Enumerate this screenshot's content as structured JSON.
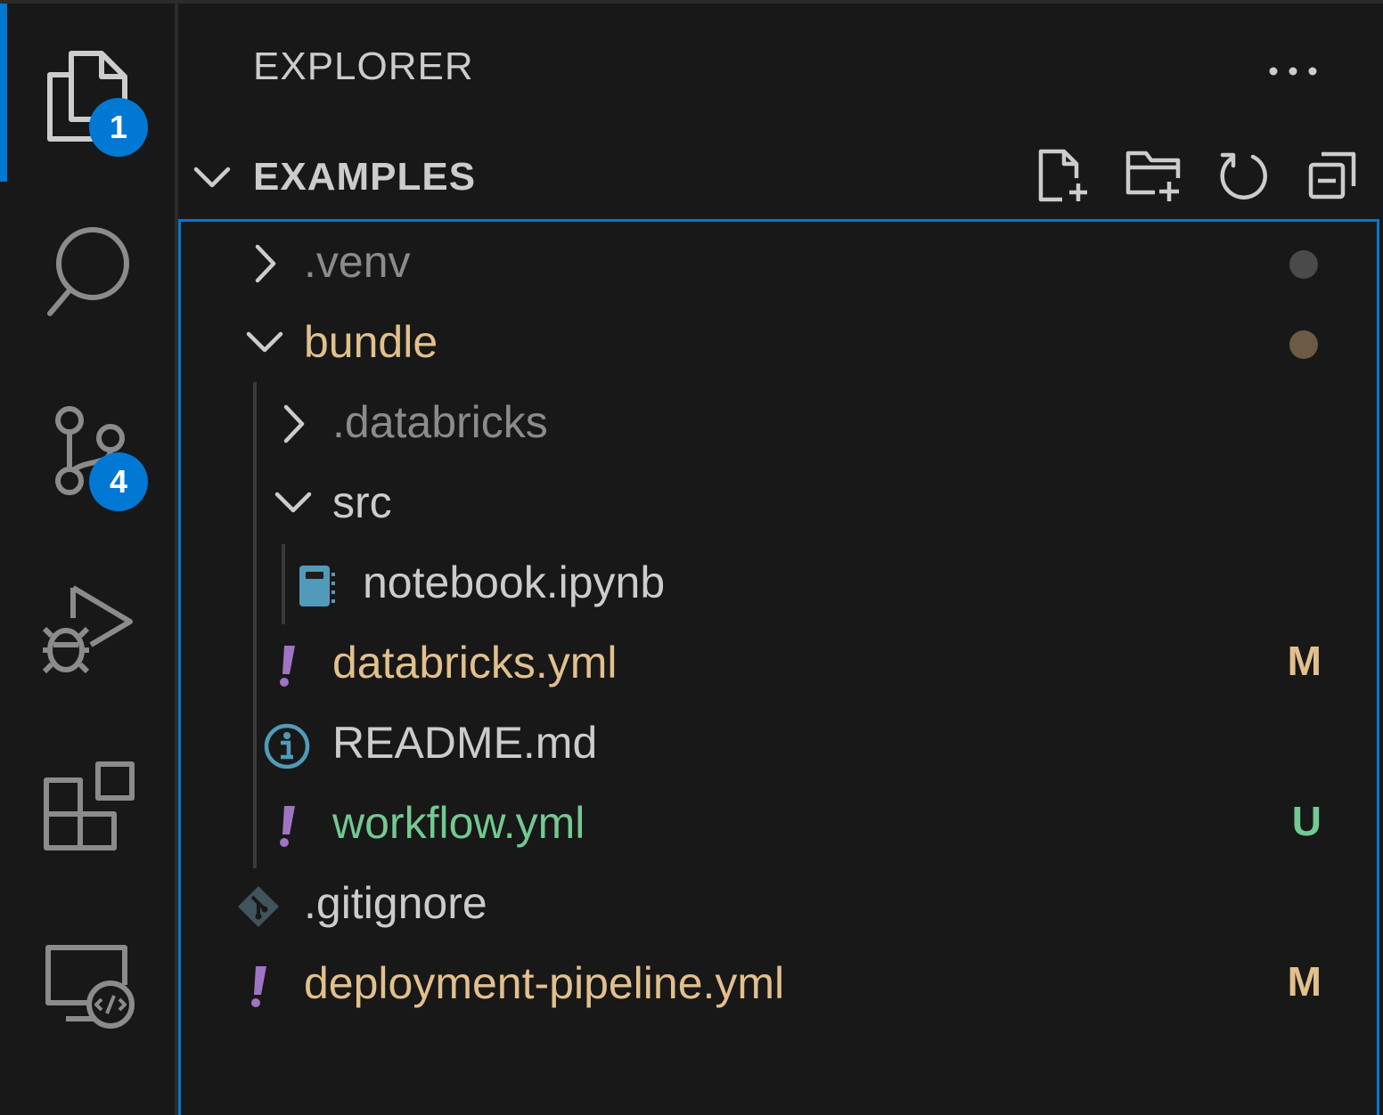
{
  "activity_bar": {
    "items": [
      {
        "id": "explorer",
        "icon": "files-icon",
        "badge": "1",
        "active": true
      },
      {
        "id": "search",
        "icon": "search-icon",
        "badge": null
      },
      {
        "id": "source-control",
        "icon": "source-control-icon",
        "badge": "4"
      },
      {
        "id": "run-debug",
        "icon": "run-debug-icon",
        "badge": null
      },
      {
        "id": "extensions",
        "icon": "extensions-icon",
        "badge": null
      },
      {
        "id": "remote-explorer",
        "icon": "remote-explorer-icon",
        "badge": null
      }
    ],
    "accent_color": "#0078d4"
  },
  "sidebar": {
    "title": "EXPLORER",
    "more_label": "···",
    "section": {
      "title": "EXAMPLES",
      "actions": [
        "new-file-icon",
        "new-folder-icon",
        "refresh-icon",
        "collapse-all-icon"
      ]
    }
  },
  "tree": [
    {
      "label": ".venv",
      "type": "folder",
      "expanded": false,
      "color": "#8b8b8b",
      "status": null,
      "dot": "#4a4a4a"
    },
    {
      "label": "bundle",
      "type": "folder",
      "expanded": true,
      "color": "#e2c08d",
      "status": null,
      "dot": "#6b5b44"
    },
    {
      "label": ".databricks",
      "type": "folder",
      "expanded": false,
      "color": "#8b8b8b",
      "status": null
    },
    {
      "label": "src",
      "type": "folder",
      "expanded": true,
      "color": "#cccccc",
      "status": null
    },
    {
      "label": "notebook.ipynb",
      "type": "file",
      "icon": "notebook-icon",
      "color": "#cccccc",
      "status": null
    },
    {
      "label": "databricks.yml",
      "type": "file",
      "icon": "yaml-icon",
      "color": "#e2c08d",
      "status": "M",
      "status_color": "#e2c08d"
    },
    {
      "label": "README.md",
      "type": "file",
      "icon": "info-icon",
      "color": "#cccccc",
      "status": null
    },
    {
      "label": "workflow.yml",
      "type": "file",
      "icon": "yaml-icon",
      "color": "#73c991",
      "status": "U",
      "status_color": "#73c991"
    },
    {
      "label": ".gitignore",
      "type": "file",
      "icon": "git-icon",
      "color": "#cccccc",
      "status": null
    },
    {
      "label": "deployment-pipeline.yml",
      "type": "file",
      "icon": "yaml-icon",
      "color": "#e2c08d",
      "status": "M",
      "status_color": "#e2c08d"
    }
  ]
}
